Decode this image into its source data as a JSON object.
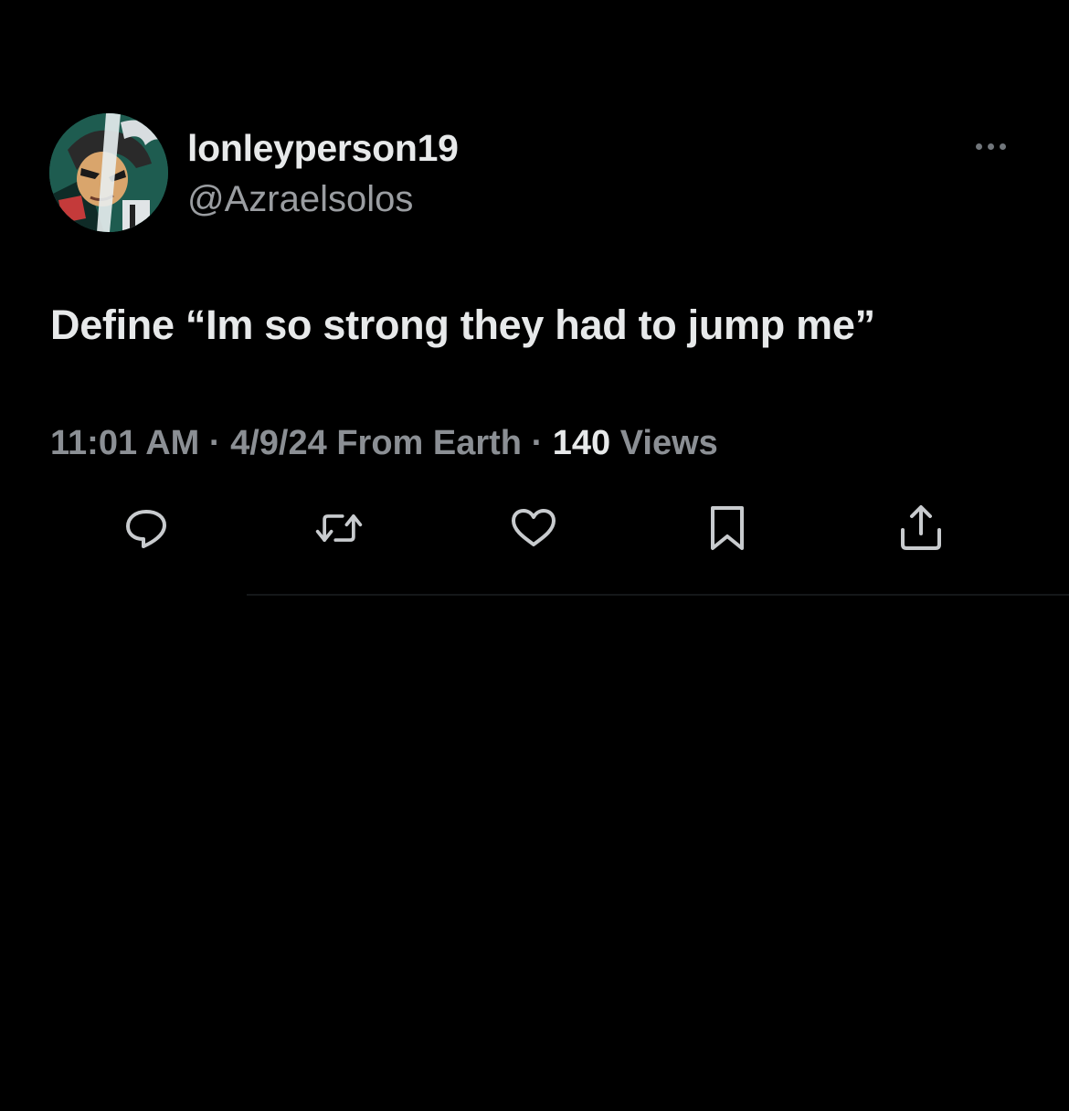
{
  "tweet": {
    "display_name": "lonleyperson19",
    "handle": "@Azraelsolos",
    "text": "Define “Im so strong they had to jump me”",
    "meta_prefix": "11:01 AM · 4/9/24 From Earth · ",
    "views_count": "140",
    "views_label": " Views"
  },
  "icons": {
    "more": "more-horizontal-icon",
    "reply": "reply-icon",
    "retweet": "retweet-icon",
    "like": "heart-icon",
    "bookmark": "bookmark-icon",
    "share": "share-icon"
  },
  "colors": {
    "background": "#000000",
    "primary_text": "#e7e9ea",
    "secondary_text": "#8b8f94",
    "icon": "#c8cbce"
  }
}
